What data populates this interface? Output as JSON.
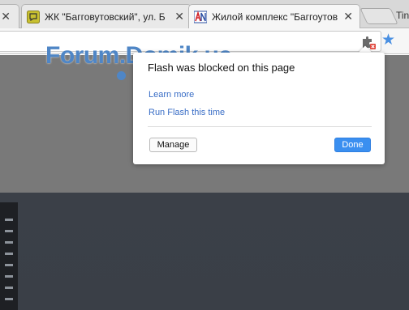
{
  "tabs": [
    {
      "title": "",
      "close": "✕"
    },
    {
      "title": "ЖК \"Багговутовский\", ул. Б",
      "close": "✕"
    },
    {
      "title": "Жилой комплекс \"Баггоутов",
      "close": "✕"
    }
  ],
  "ghost_tab": "Tin",
  "watermark": {
    "text": "Forum.Domik.ua",
    "colors": [
      "#4f86c6",
      "#c9d45a",
      "#d0507a"
    ]
  },
  "flash_bubble": {
    "title": "Flash was blocked on this page",
    "learn_more": "Learn more",
    "run_flash": "Run Flash this time",
    "manage_label": "Manage",
    "done_label": "Done"
  },
  "icons": {
    "plugin": "puzzle-blocked-icon",
    "bookmark": "star-icon"
  },
  "colors": {
    "link": "#3a6ec6",
    "done_button": "#3a8ff0",
    "watermark": "#4f86c6"
  }
}
